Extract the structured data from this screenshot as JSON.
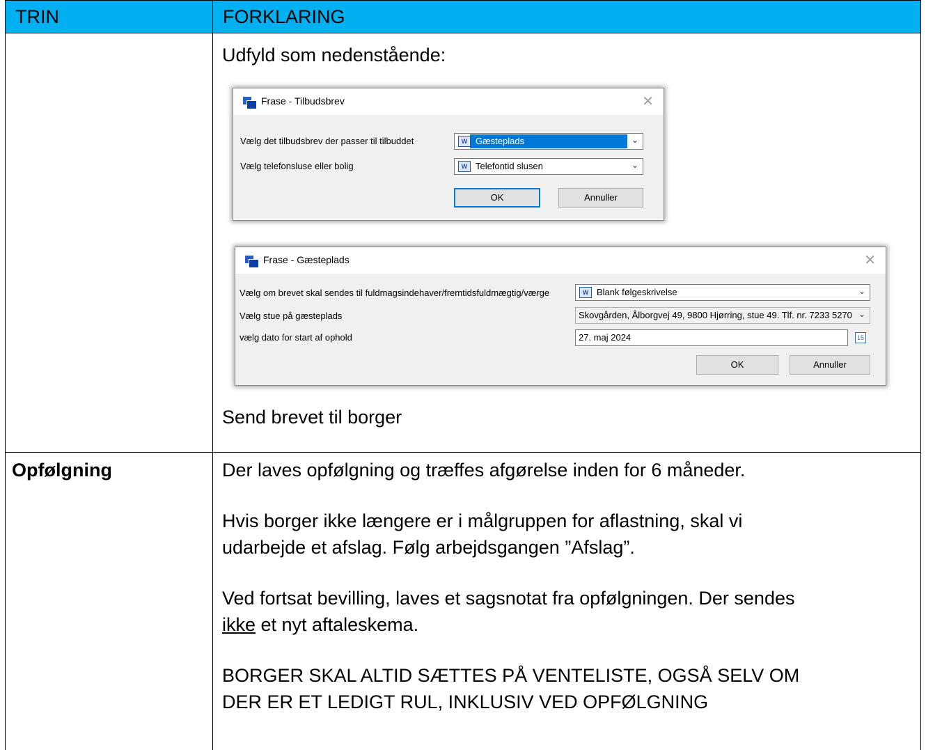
{
  "header": {
    "col1": "TRIN",
    "col2": "FORKLARING"
  },
  "row1": {
    "intro": "Udfyld som nedenstående:",
    "dialog1": {
      "title": "Frase - Tilbudsbrev",
      "close": "✕",
      "label1": "Vælg det tilbudsbrev der passer til tilbuddet",
      "value1": "Gæsteplads",
      "label2": "Vælg  telefonsluse eller bolig",
      "value2": "Telefontid slusen",
      "ok": "OK",
      "cancel": "Annuller"
    },
    "dialog2": {
      "title": "Frase - Gæsteplads",
      "close": "✕",
      "label1": "Vælg om brevet skal sendes til fuldmagsindehaver/fremtidsfuldmægtig/værge",
      "value1": "Blank følgeskrivelse",
      "label2": "Vælg stue på gæsteplads",
      "value2": "Skovgården, Ålborgvej 49, 9800 Hjørring, stue 49. Tlf. nr. 7233 5270",
      "label3": "vælg dato for start af ophold",
      "value3": "27. maj 2024",
      "ok": "OK",
      "cancel": "Annuller"
    },
    "outro": "Send brevet til borger"
  },
  "row2": {
    "step": "Opfølgning",
    "p1": "Der laves opfølgning og træffes afgørelse inden for 6 måneder.",
    "p2_line1": "Hvis borger ikke længere er i målgruppen for aflastning, skal vi",
    "p2_line2": "udarbejde et afslag. Følg arbejdsgangen ”Afslag”.",
    "p3_line1": "Ved fortsat bevilling, laves et sagsnotat fra opfølgningen. Der sendes",
    "p3_line2_u": "ikke",
    "p3_line2_rest": " et nyt aftaleskema.",
    "p4_line1": "BORGER SKAL ALTID SÆTTES PÅ VENTELISTE, OGSÅ SELV OM",
    "p4_line2": "DER ER ET LEDIGT RUL, INKLUSIV VED OPFØLGNING"
  }
}
